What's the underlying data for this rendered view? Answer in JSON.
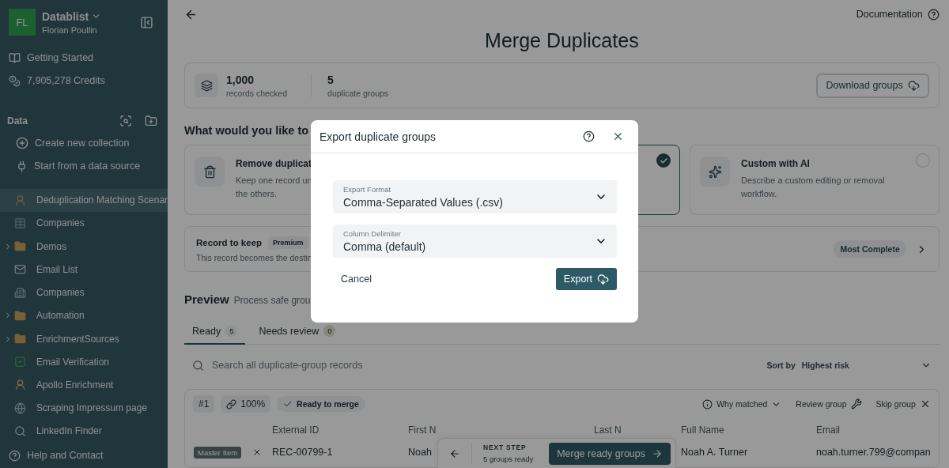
{
  "sidebar": {
    "workspace": {
      "initials": "FL",
      "name": "Datablist",
      "user": "Florian Poullin"
    },
    "links": [
      {
        "label": "Getting Started",
        "kind": "guide"
      },
      {
        "label": "7,905,278 Credits",
        "kind": "credits"
      }
    ],
    "section_title": "Data",
    "actions": [
      {
        "label": "Create new collection",
        "kind": "create"
      },
      {
        "label": "Start from a data source",
        "kind": "source"
      }
    ],
    "items": [
      {
        "label": "Deduplication Matching Scenar",
        "kind": "collection",
        "selected": true
      },
      {
        "label": "Companies",
        "kind": "collection",
        "selected": false
      },
      {
        "label": "Demos",
        "kind": "folder",
        "selected": false
      },
      {
        "label": "Email List",
        "kind": "collection",
        "selected": false
      },
      {
        "label": "Companies",
        "kind": "collection",
        "selected": false
      },
      {
        "label": "Automation",
        "kind": "folder",
        "selected": false
      },
      {
        "label": "EnrichmentSources",
        "kind": "folder",
        "selected": false
      },
      {
        "label": "Email Verification",
        "kind": "collection",
        "selected": false
      },
      {
        "label": "Apollo Enrichment",
        "kind": "collection",
        "selected": false
      },
      {
        "label": "Scraping Impressum page",
        "kind": "collection",
        "selected": false
      },
      {
        "label": "LinkedIn Finder",
        "kind": "collection",
        "selected": false
      }
    ],
    "help": "Help and Contact"
  },
  "topbar": {
    "link": "Documentation"
  },
  "title": "Merge Duplicates",
  "stats": [
    {
      "value": "1,000",
      "label": "records checked"
    },
    {
      "value": "5",
      "label": "duplicate groups"
    }
  ],
  "download_button": "Download groups",
  "options_heading": "What would you like to",
  "options": [
    {
      "title": "Remove duplicat",
      "description": [
        "Keep one record un",
        "the others."
      ],
      "selected": false,
      "kind": "remove"
    },
    {
      "selected": true,
      "kind": "merge"
    },
    {
      "title": "Custom with AI",
      "description": [
        "Describe a custom editing or removal",
        "workflow."
      ],
      "selected": false,
      "kind": "ai"
    }
  ],
  "record_to_keep": {
    "title": "Record to keep",
    "badge": "Premium",
    "description": "This record becomes the destin",
    "value": "Most Complete"
  },
  "preview": {
    "title": "Preview",
    "subtitle": "Process safe grou",
    "tabs": [
      {
        "label": "Ready",
        "count": "5",
        "selected": true
      },
      {
        "label": "Needs review",
        "count": "0",
        "selected": false
      }
    ],
    "search": {
      "placeholder": "Search all duplicate-group records"
    },
    "sort": {
      "label": "Sort by",
      "value": "Highest risk"
    },
    "group": {
      "number": "#1",
      "match": "100%",
      "status": "Ready to merge",
      "actions": [
        {
          "label": "Why matched",
          "kind": "info"
        },
        {
          "label": "Review group",
          "kind": "review"
        },
        {
          "label": "Skip group",
          "kind": "skip"
        }
      ],
      "columns": [
        "External ID",
        "First N",
        "Last N",
        "Full Name",
        "Email"
      ],
      "rows": [
        {
          "badge": "Master Item",
          "cells": [
            "REC-00799-1",
            "Noah",
            null,
            "Noah A. Turner",
            "noah.turner.799@compan"
          ]
        }
      ]
    }
  },
  "next_step": {
    "label": "NEXT STEP",
    "status": "5 groups ready",
    "button": "Merge ready groups"
  },
  "dialog": {
    "title": "Export duplicate groups",
    "fields": [
      {
        "label": "Export Format",
        "value": "Comma-Separated Values (.csv)"
      },
      {
        "label": "Column Delimiter",
        "value": "Comma (default)"
      }
    ],
    "cancel": "Cancel",
    "confirm": "Export"
  }
}
